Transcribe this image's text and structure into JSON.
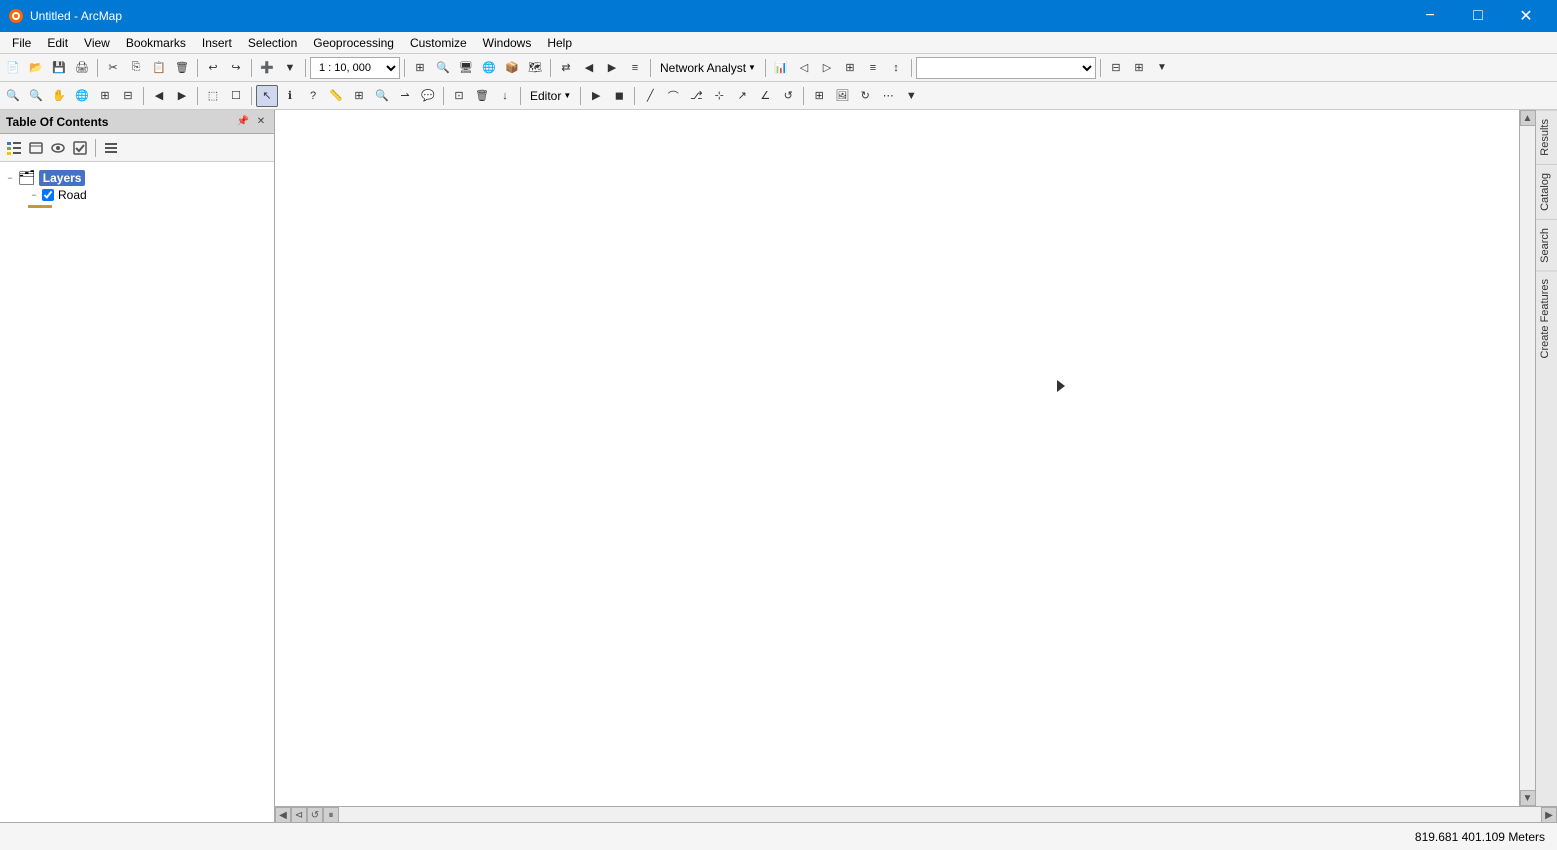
{
  "titlebar": {
    "title": "Untitled - ArcMap",
    "minimize_label": "−",
    "maximize_label": "□",
    "close_label": "✕"
  },
  "menu": {
    "items": [
      "File",
      "Edit",
      "View",
      "Bookmarks",
      "Insert",
      "Selection",
      "Geoprocessing",
      "Customize",
      "Windows",
      "Help"
    ]
  },
  "toolbar1": {
    "scale_value": "1 : 10, 000",
    "network_analyst_label": "Network Analyst",
    "na_dropdown_arrow": "▼"
  },
  "toc": {
    "title": "Table Of Contents",
    "layers_label": "Layers",
    "road_label": "Road"
  },
  "map": {
    "background": "#ffffff"
  },
  "right_tabs": [
    "Results",
    "Catalog",
    "Search",
    "Create Features"
  ],
  "statusbar": {
    "coords": "819.681  401.109 Meters"
  }
}
